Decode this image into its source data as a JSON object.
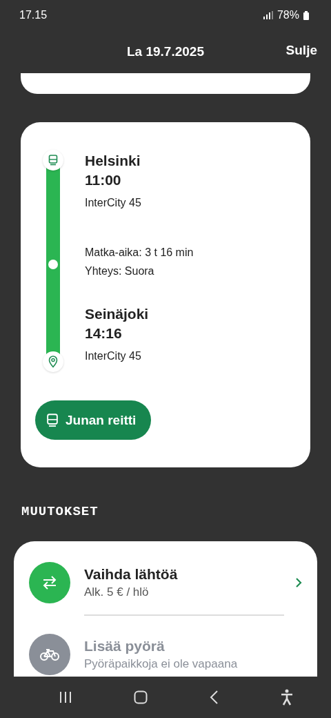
{
  "status_bar": {
    "time": "17.15",
    "battery": "78%"
  },
  "header": {
    "title": "La 19.7.2025",
    "close": "Sulje"
  },
  "journey": {
    "departure": {
      "station": "Helsinki",
      "time": "11:00",
      "train": "InterCity 45"
    },
    "duration": "Matka-aika: 3 t 16 min",
    "connection": "Yhteys: Suora",
    "arrival": {
      "station": "Seinäjoki",
      "time": "14:16",
      "train": "InterCity 45"
    },
    "route_button": "Junan reitti"
  },
  "changes": {
    "heading": "MUUTOKSET",
    "items": [
      {
        "kind": "swap",
        "title": "Vaihda lähtöä",
        "subtitle": "Alk. 5 € / hlö",
        "disabled": false
      },
      {
        "kind": "bike",
        "title": "Lisää pyörä",
        "subtitle": "Pyöräpaikkoja ei ole vapaana",
        "disabled": true
      }
    ]
  }
}
